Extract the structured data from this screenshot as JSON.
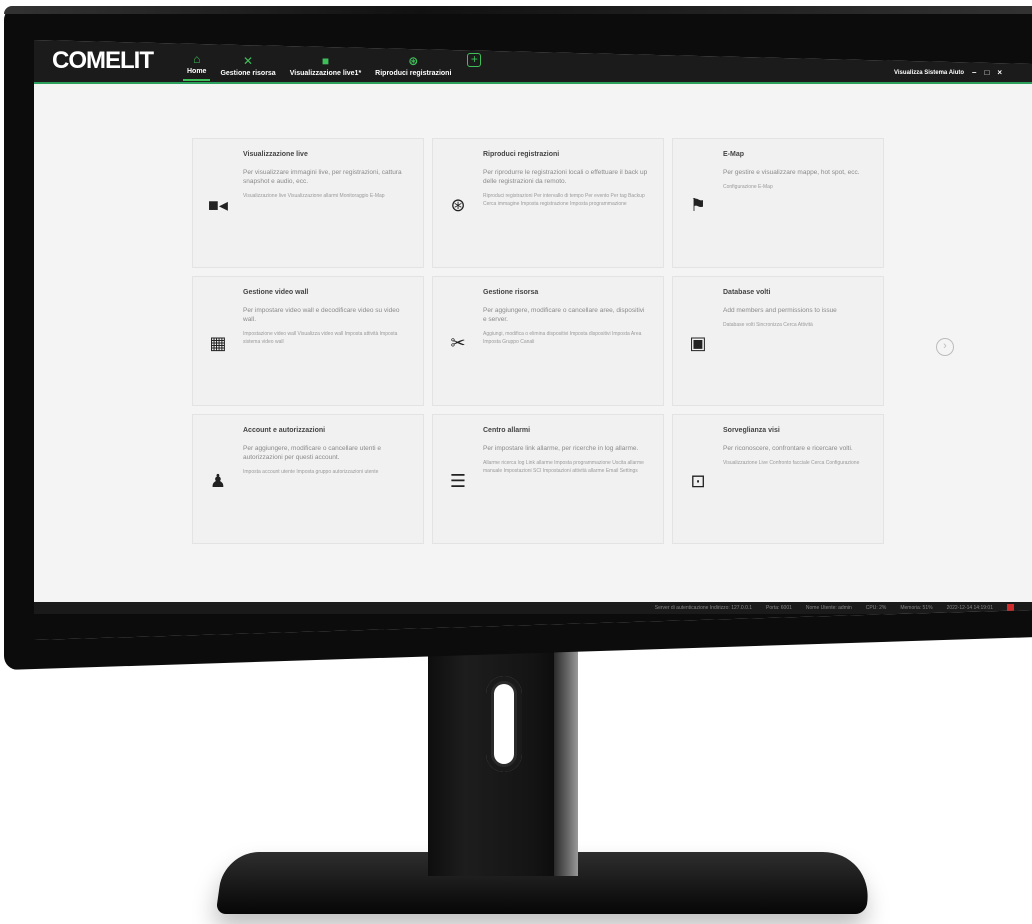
{
  "app": {
    "logo": "COMELIT",
    "window_title": "Visualizza Sistema Aiuto"
  },
  "tabs": [
    {
      "label": "Home",
      "icon": "home-icon"
    },
    {
      "label": "Gestione risorsa",
      "icon": "tools-icon"
    },
    {
      "label": "Visualizzazione live1*",
      "icon": "camera-icon"
    },
    {
      "label": "Riproduci registrazioni",
      "icon": "film-reel-icon"
    }
  ],
  "cards": [
    {
      "title": "Visualizzazione live",
      "desc": "Per visualizzare immagini live, per registrazioni, cattura snapshot e audio, ecc.",
      "links": "Visualizzazione live   Visualizzazione allarmi   Monitoraggio E-Map",
      "icon": "camera-icon"
    },
    {
      "title": "Riproduci registrazioni",
      "desc": "Per riprodurre le registrazioni locali o effettuare il back up delle registrazioni da remoto.",
      "links": "Riproduci registrazioni   Per intervallo di tempo   Per evento   Per tag   Backup   Cerca immagine   Imposta registrazione   Imposta programmazione",
      "icon": "film-reel-icon"
    },
    {
      "title": "E-Map",
      "desc": "Per gestire e visualizzare mappe, hot spot, ecc.",
      "links": "Configurazione E-Map",
      "icon": "flag-icon"
    },
    {
      "title": "Gestione video wall",
      "desc": "Per impostare video wall e decodificare video su video wall.",
      "links": "Impostazione video wall   Visualizza video wall   Imposta attività   Imposta sistema video wall",
      "icon": "video-wall-icon"
    },
    {
      "title": "Gestione risorsa",
      "desc": "Per aggiungere, modificare o cancellare aree, dispositivi e server.",
      "links": "Aggiungi, modifica o elimina dispositivi   Imposta dispositivi   Imposta Area   Imposta Gruppo Canali",
      "icon": "tools-icon"
    },
    {
      "title": "Database volti",
      "desc": "Add members and permissions to issue",
      "links": "Database volti   Sincronizza   Cerca   Attività",
      "icon": "face-database-icon"
    },
    {
      "title": "Account e autorizzazioni",
      "desc": "Per aggiungere, modificare o cancellare utenti e autorizzazioni per questi account.",
      "links": "Imposta account utente   Imposta gruppo autorizzazioni utente",
      "icon": "user-permission-icon"
    },
    {
      "title": "Centro allarmi",
      "desc": "Per impostare link allarme, per ricerche in log allarme.",
      "links": "Allarme ricerca log   Link allarme   Imposta programmazione   Uscita allarme manuale   Impostazioni SCI   Impostazioni attività allarme   Email Settings",
      "icon": "alarm-center-icon"
    },
    {
      "title": "Sorveglianza visi",
      "desc": "Per riconoscere, confrontare e ricercare volti.",
      "links": "Visualizzazione Live   Confronto facciale   Cerca   Configurazione",
      "icon": "face-surveillance-icon"
    }
  ],
  "status": {
    "auth_server": "Server di autenticazione Indirizzo: 127.0.0.1",
    "port": "Porta: 6001",
    "user": "Nome Utente: admin",
    "cpu": "CPU: 2%",
    "memory": "Memoria: 51%",
    "datetime": "2022-12-14 14:19:01"
  }
}
